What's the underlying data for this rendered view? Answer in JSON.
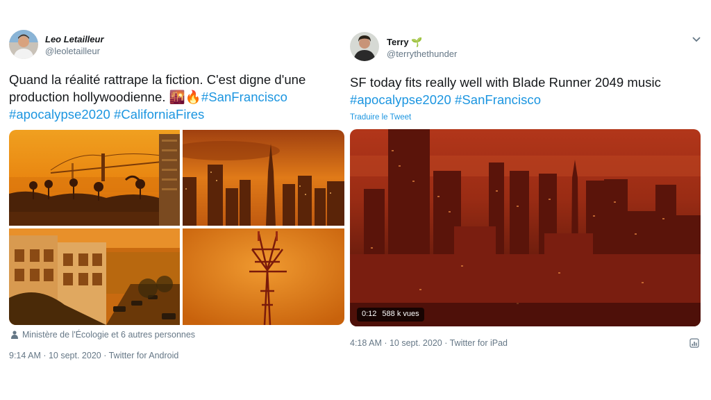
{
  "tweet1": {
    "author_name": "Leo Letailleur",
    "author_handle": "@leoletailleur",
    "text_line1": "Quand la réalité rattrape la fiction. C'est digne d'une",
    "text_line2_prefix": "production hollywoodienne.",
    "emojis": "🌇🔥",
    "hashtags": [
      "#SanFrancisco",
      "#apocalypse2020",
      "#CaliforniaFires"
    ],
    "tagged_people": "Ministère de l'Écologie et 6 autres personnes",
    "timestamp": "9:14 AM · 10 sept. 2020 · Twitter for Android",
    "photos": [
      "golden-gate-bridge-orange-sky",
      "transamerica-skyline",
      "street-houses-orange",
      "sutro-tower-fog"
    ],
    "icons": [
      "person-tag-icon"
    ]
  },
  "tweet2": {
    "author_name": "Terry",
    "author_badge": "🌱",
    "author_handle": "@terrythethunder",
    "text_line1": "SF today fits really well with Blade Runner 2049 music",
    "hashtags": [
      "#apocalypse2020",
      "#SanFrancisco"
    ],
    "translate_link": "Traduire le Tweet",
    "video_duration": "0:12",
    "video_views": "588 k vues",
    "timestamp": "4:18 AM · 10 sept. 2020 · Twitter for iPad",
    "icons": [
      "chevron-down-icon",
      "analytics-icon"
    ]
  },
  "colors": {
    "link": "#1b95e0",
    "text": "#14171a",
    "secondary": "#657786",
    "orange_sky": "#e8780f",
    "red_sky": "#8e2512"
  }
}
